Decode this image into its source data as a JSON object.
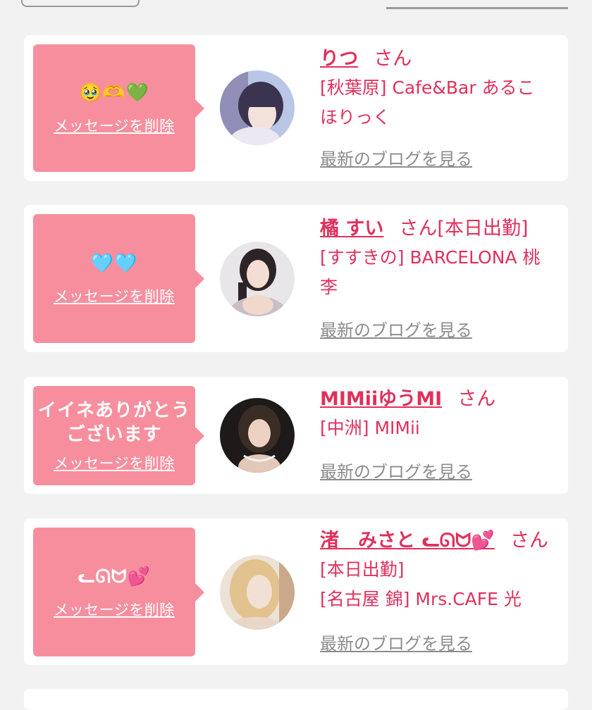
{
  "cards": [
    {
      "message": "🥹🫶💚",
      "delete_label": "メッセージを削除",
      "name": "りつ",
      "honorific": "さん",
      "status": "",
      "shop_lines": [
        "[秋葉原] Cafe&Bar あるこ",
        "ほりっく"
      ],
      "blog_label": "最新のブログを見る"
    },
    {
      "message": "🩵🩵",
      "delete_label": "メッセージを削除",
      "name": "橘 すい",
      "honorific": "さん",
      "status": "[本日出勤]",
      "shop_lines": [
        "[すすきの] BARCELONA 桃",
        "李"
      ],
      "blog_label": "最新のブログを見る"
    },
    {
      "message_lines": [
        "イイネありがとう",
        "ございます"
      ],
      "delete_label": "メッセージを削除",
      "name": "MIMiiゆうMI",
      "honorific": "さん",
      "status": "",
      "shop_lines": [
        "[中洲] MIMii"
      ],
      "blog_label": "最新のブログを見る"
    },
    {
      "message": "ᓚᘏᗢ💕",
      "delete_label": "メッセージを削除",
      "name": "渚　みさと ᓚᘏᗢ💕",
      "honorific": "さん",
      "status": "[本日出勤]",
      "shop_lines": [
        "[名古屋 錦] Mrs.CAFE 光"
      ],
      "blog_label": "最新のブログを見る"
    }
  ],
  "colors": {
    "bubble": "#f78e9e",
    "accent": "#e0305c",
    "link_gray": "#8c8c8c",
    "background": "#f2f2f2"
  }
}
